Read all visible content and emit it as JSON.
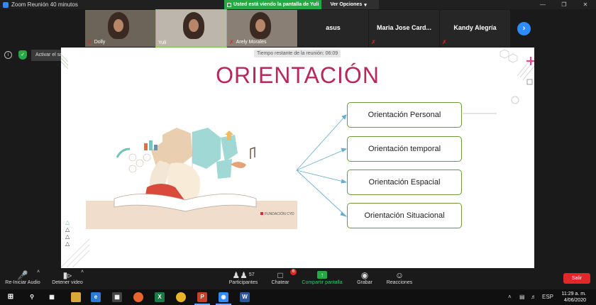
{
  "window": {
    "title": "Zoom Reunión 40 minutos"
  },
  "share_banner": {
    "text": "Usted está viendo la pantalla de Yuli",
    "options_label": "Ver Opciones"
  },
  "gallery": {
    "tiles": [
      {
        "name": "Dolly",
        "video": true,
        "muted": true
      },
      {
        "name": "Yuli",
        "video": true,
        "muted": false
      },
      {
        "name": "Arely Morales",
        "video": true,
        "muted": true
      },
      {
        "name": "asus",
        "video": false,
        "muted": false
      },
      {
        "name": "Maria Jose Card...",
        "video": false,
        "muted": true
      },
      {
        "name": "Kandy Alegría",
        "video": false,
        "muted": true
      }
    ]
  },
  "left_controls": {
    "original_sound_label": "Activar el sonido original"
  },
  "slide": {
    "timer_text": "Tiempo restante de la reunión: 06:09",
    "title": "ORIENTACIÓN",
    "options": [
      "Orientación Personal",
      "Orientación temporal",
      "Orientación Espacial",
      "Orientación Situacional"
    ],
    "brand_text": "FUNDACIÓN CYD",
    "colors": {
      "title": "#b7285d",
      "box_border": "#6a9a3a",
      "arrow": "#6aaecf"
    }
  },
  "toolbar": {
    "audio_label": "Re-Iniciar Audio",
    "video_label": "Detener video",
    "participants_label": "Participantes",
    "participants_count": "57",
    "chat_label": "Chatear",
    "chat_badge": "6",
    "share_label": "Compartir pantalla",
    "record_label": "Grabar",
    "reactions_label": "Reacciones",
    "exit_label": "Salir"
  },
  "taskbar": {
    "time": "11:29 a. m.",
    "date": "4/06/2020",
    "apps": [
      "windows-start",
      "search",
      "task-view",
      "file-explorer",
      "edge",
      "store",
      "firefox",
      "excel",
      "chrome",
      "powerpoint",
      "zoom",
      "word"
    ]
  }
}
